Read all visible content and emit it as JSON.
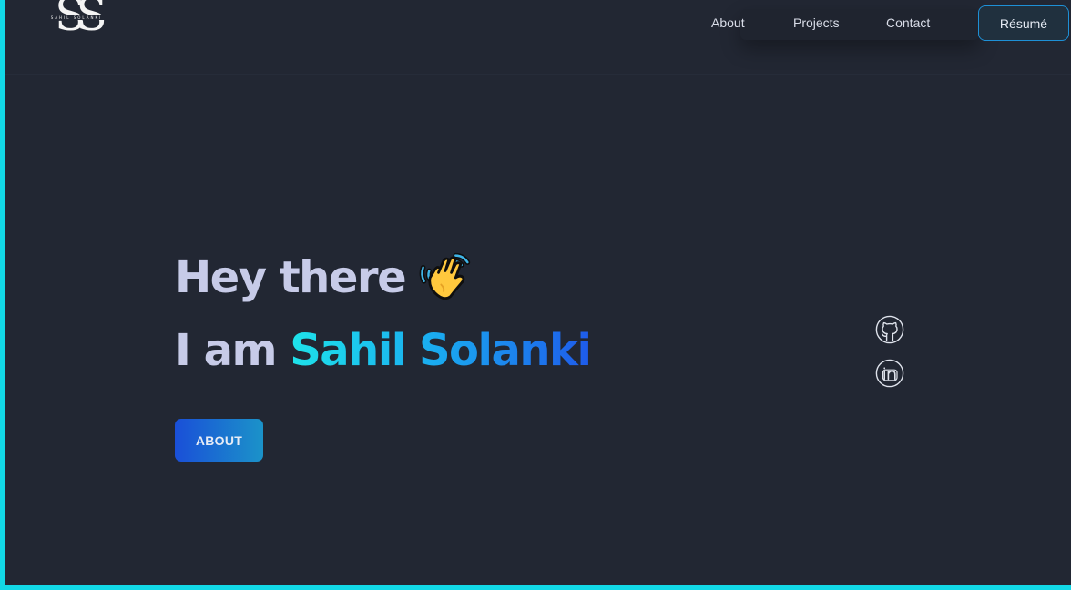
{
  "logo": {
    "mark": "SS",
    "subtitle": "SAHIL SOLANKI"
  },
  "nav": {
    "items": [
      {
        "label": "About"
      },
      {
        "label": "Projects"
      },
      {
        "label": "Contact"
      }
    ],
    "resume_label": "Résumé"
  },
  "hero": {
    "greeting": "Hey there",
    "intro": "I am",
    "name": "Sahil Solanki",
    "wave_icon": "waving-hand-emoji",
    "cta_label": "ABOUT"
  },
  "social": {
    "github_icon": "github-icon",
    "linkedin_icon": "linkedin-icon"
  },
  "colors": {
    "background": "#222733",
    "accent_cyan": "#12d8e6",
    "name_gradient_start": "#1ee3ea",
    "name_gradient_end": "#1e5bea",
    "headline_text": "#c7cbe8"
  }
}
